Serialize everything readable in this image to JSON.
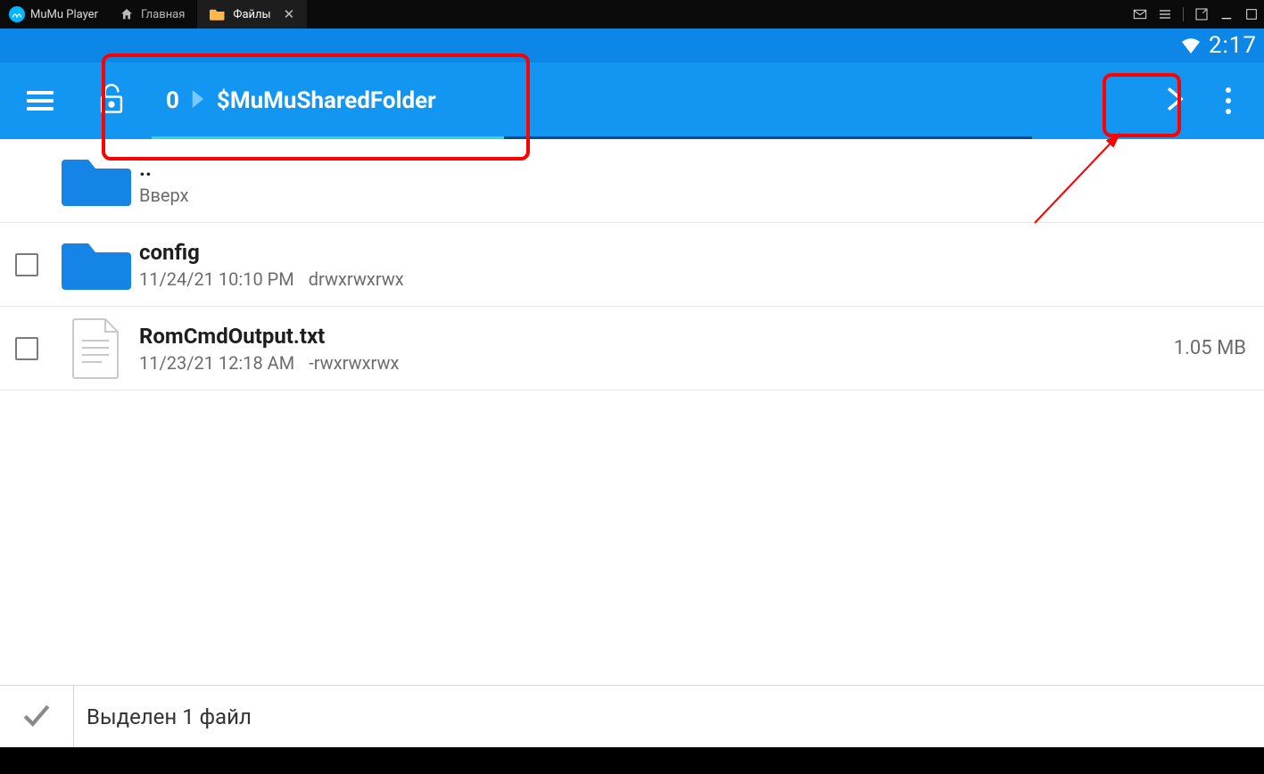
{
  "titlebar": {
    "brand": "MuMu Player",
    "tabs": [
      {
        "label": "Главная",
        "type": "home",
        "active": false
      },
      {
        "label": "Файлы",
        "type": "app",
        "active": true
      }
    ]
  },
  "statusbar": {
    "time": "2:17"
  },
  "appbar": {
    "count": "0",
    "folder": "$MuMuSharedFolder"
  },
  "files": {
    "up": {
      "name": "..",
      "label": "Вверх"
    },
    "entries": [
      {
        "kind": "folder",
        "name": "config",
        "date": "11/24/21 10:10 PM",
        "perm": "drwxrwxrwx",
        "size": ""
      },
      {
        "kind": "file",
        "name": "RomCmdOutput.txt",
        "date": "11/23/21 12:18 AM",
        "perm": "-rwxrwxrwx",
        "size": "1.05 MB"
      }
    ]
  },
  "selection": {
    "text": "Выделен 1 файл"
  }
}
